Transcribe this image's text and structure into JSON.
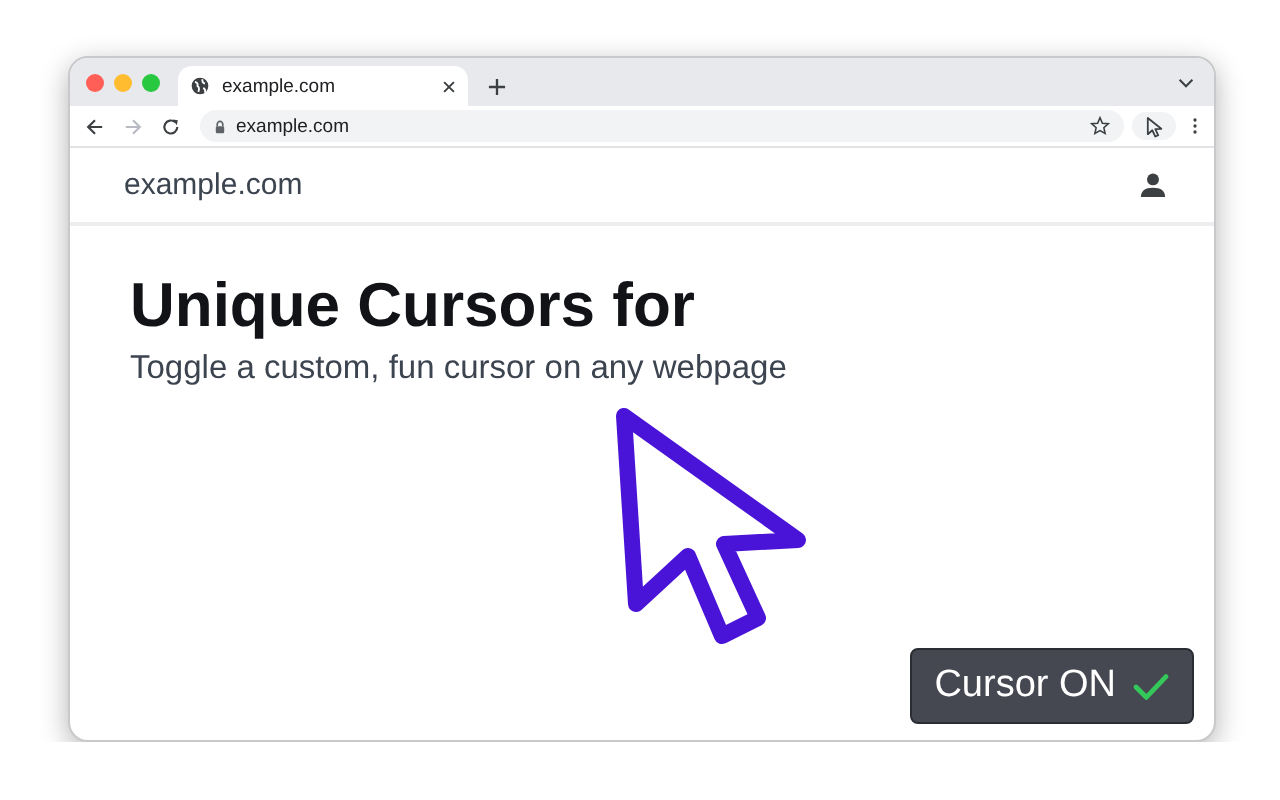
{
  "browser": {
    "tab": {
      "title": "example.com",
      "selected": true
    },
    "address": "example.com"
  },
  "site": {
    "logo": "example.com"
  },
  "hero": {
    "heading": "Unique Cursors for",
    "subtitle": "Toggle a custom, fun cursor on any webpage"
  },
  "cursor_toggle": {
    "label": "Cursor ON",
    "on": true
  }
}
